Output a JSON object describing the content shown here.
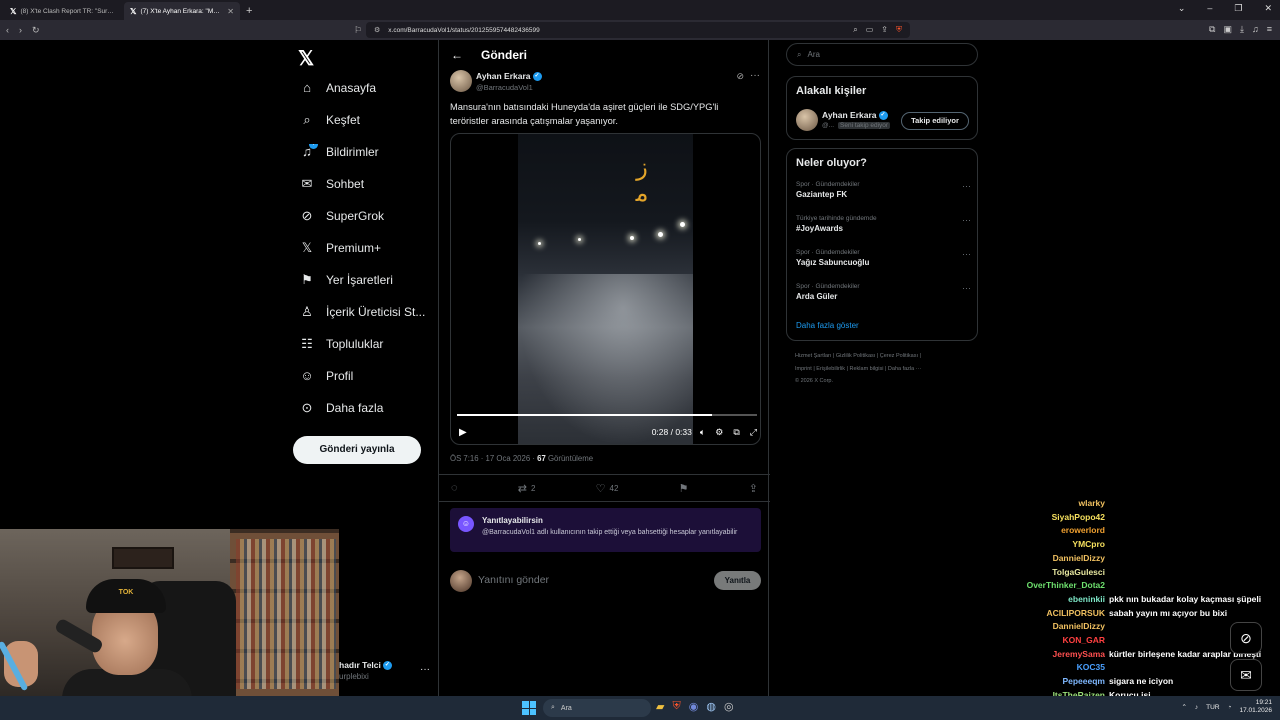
{
  "browser": {
    "tabs": [
      {
        "title": "(8) X'te Clash Report TR: \"Suriye ordu",
        "active": false
      },
      {
        "title": "(7) X'te Ayhan Erkara: \"Mansura'",
        "active": true
      }
    ],
    "url": "x.com/BarracudaVol1/status/2012559574482436599"
  },
  "nav": {
    "items": [
      {
        "label": "Anasayfa",
        "icon": "home-icon",
        "glyph": "⌂"
      },
      {
        "label": "Keşfet",
        "icon": "search-icon",
        "glyph": "⌕"
      },
      {
        "label": "Bildirimler",
        "icon": "bell-icon",
        "glyph": "♫",
        "badge": "7"
      },
      {
        "label": "Sohbet",
        "icon": "mail-icon",
        "glyph": "✉"
      },
      {
        "label": "SuperGrok",
        "icon": "grok-icon",
        "glyph": "⊘"
      },
      {
        "label": "Premium+",
        "icon": "x-premium-icon",
        "glyph": "𝕏"
      },
      {
        "label": "Yer İşaretleri",
        "icon": "bookmark-icon",
        "glyph": "⚑"
      },
      {
        "label": "İçerik Üreticisi St...",
        "icon": "creator-studio-icon",
        "glyph": "♙"
      },
      {
        "label": "Topluluklar",
        "icon": "communities-icon",
        "glyph": "☷"
      },
      {
        "label": "Profil",
        "icon": "profile-icon",
        "glyph": "☺"
      },
      {
        "label": "Daha fazla",
        "icon": "more-circle-icon",
        "glyph": "⊙"
      }
    ],
    "post_button": "Gönderi yayınla",
    "account_name": "hadır Telci",
    "account_handle": "urplebixi"
  },
  "header": {
    "title": "Gönderi"
  },
  "post": {
    "author_name": "Ayhan Erkara",
    "author_handle": "@BarracudaVol1",
    "text": "Mansura'nın batısındaki Huneyda'da aşiret güçleri ile SDG/YPG'li teröristler arasında çatışmalar yaşanıyor.",
    "video_time": "0:28 / 0:33",
    "video_progress": 0.85,
    "timestamp": "ÖS 7:16 · 17 Oca 2026 · ",
    "views_count": "67",
    "views_label": " Görüntüleme",
    "actions": {
      "reposts": "2",
      "likes": "42"
    }
  },
  "reply_restriction": {
    "title": "Yanıtlayabilirsin",
    "text": "@BarracudaVol1 adlı kullanıcının takip ettiği veya bahsettiği hesaplar yanıtlayabilir"
  },
  "reply_box": {
    "placeholder": "Yanıtını gönder",
    "button": "Yanıtla"
  },
  "sidebar": {
    "search_placeholder": "Ara",
    "related_title": "Alakalı kişiler",
    "related": {
      "name": "Ayhan Erkara",
      "handle": "@...",
      "follows_you": "Seni takip ediyor",
      "button": "Takip ediliyor"
    },
    "trends_title": "Neler oluyor?",
    "trends": [
      {
        "context": "Spor · Gündemdekiler",
        "name": "Gaziantep FK"
      },
      {
        "context": "Türkiye tarihinde gündemde",
        "name": "#JoyAwards"
      },
      {
        "context": "Spor · Gündemdekiler",
        "name": "Yağız Sabuncuoğlu"
      },
      {
        "context": "Spor · Gündemdekiler",
        "name": "Arda Güler"
      }
    ],
    "show_more": "Daha fazla göster",
    "footer": [
      "Hizmet Şartları  |  Gizlilik Politikası  |  Çerez Politikası  |",
      "Imprint  |  Erişilebilirlik  |  Reklam bilgisi  |  Daha fazla ···",
      "© 2026 X Corp."
    ]
  },
  "chat": [
    {
      "user": "wlarky",
      "msg": "",
      "color": "#f0c060"
    },
    {
      "user": "SiyahPopo42",
      "msg": "",
      "color": "#f6e05e"
    },
    {
      "user": "erowerlord",
      "msg": "",
      "color": "#f0a030"
    },
    {
      "user": "YMCpro",
      "msg": "",
      "color": "#f6e05e"
    },
    {
      "user": "DannielDizzy",
      "msg": "",
      "color": "#f0c060"
    },
    {
      "user": "TolgaGulesci",
      "msg": "",
      "color": "#e8e8a0"
    },
    {
      "user": "OverThinker_Dota2",
      "msg": "",
      "color": "#6ee06e"
    },
    {
      "user": "ebeninkii",
      "msg": "pkk nın bukadar kolay kaçması şüpeli",
      "color": "#7ee8c8"
    },
    {
      "user": "ACILIPORSUK",
      "msg": "sabah yayın mı açıyor bu bixi",
      "color": "#f0c060"
    },
    {
      "user": "DannielDizzy",
      "msg": "",
      "color": "#f0c060"
    },
    {
      "user": "KON_GAR",
      "msg": "",
      "color": "#ff4040"
    },
    {
      "user": "JeremySama",
      "msg": "kürtler birleşene kadar araplar birleşti",
      "color": "#ff5050"
    },
    {
      "user": "KOC35",
      "msg": "",
      "color": "#4aa0ff"
    },
    {
      "user": "Pepeeeqm",
      "msg": "sigara ne iciyon",
      "color": "#7fb8ff"
    },
    {
      "user": "ItsTheRaizen",
      "msg": "Korucu işi",
      "color": "#9be07a"
    }
  ],
  "taskbar": {
    "search": "Ara",
    "lang": "TUR",
    "time": "19:21",
    "date": "17.01.2026"
  },
  "webcam": {
    "cap_text": "TOK"
  }
}
